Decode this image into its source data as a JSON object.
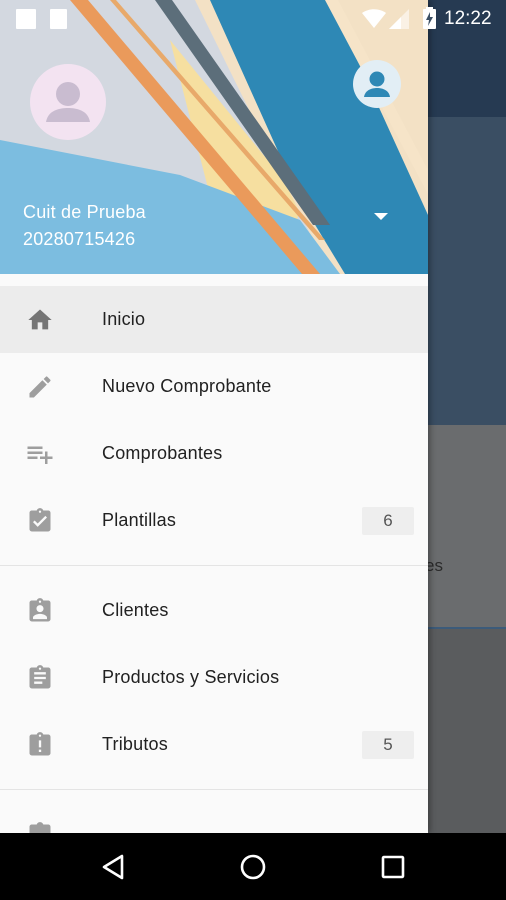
{
  "status_bar": {
    "time": "12:22"
  },
  "account": {
    "name": "Cuit de Prueba",
    "id": "20280715426"
  },
  "menu": {
    "group1": [
      {
        "label": "Inicio",
        "icon": "home-icon",
        "active": true
      },
      {
        "label": "Nuevo Comprobante",
        "icon": "pencil-icon"
      },
      {
        "label": "Comprobantes",
        "icon": "playlist-add-icon"
      },
      {
        "label": "Plantillas",
        "icon": "clipboard-check-icon",
        "count": "6"
      }
    ],
    "group2": [
      {
        "label": "Clientes",
        "icon": "clipboard-account-icon"
      },
      {
        "label": "Productos y Servicios",
        "icon": "clipboard-text-icon"
      },
      {
        "label": "Tributos",
        "icon": "clipboard-alert-icon",
        "count": "5"
      }
    ]
  },
  "background_partial_text": "es",
  "colors": {
    "header_blue": "#2e88b5",
    "orange_stripe": "#ea9a5b",
    "icon_grey": "#757575"
  }
}
